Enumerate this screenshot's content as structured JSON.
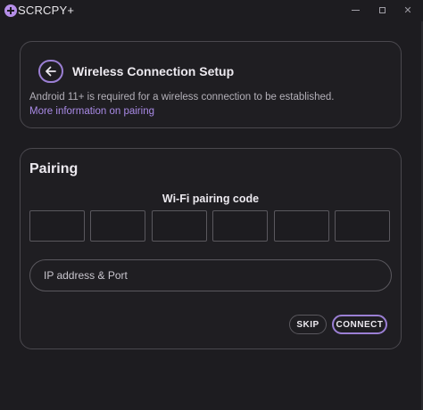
{
  "titlebar": {
    "app_name": "SCRCPY+",
    "icons": {
      "logo": "plus-circle-icon",
      "minimize": "minimize-icon",
      "maximize": "maximize-icon",
      "close": "close-icon"
    },
    "close_glyph": "✕"
  },
  "setup": {
    "back_icon": "arrow-left-icon",
    "title": "Wireless Connection Setup",
    "description": "Android 11+ is required for a wireless connection to be established.",
    "link": "More information on pairing"
  },
  "pairing": {
    "title": "Pairing",
    "code_label": "Wi-Fi pairing code",
    "code_digits": [
      "",
      "",
      "",
      "",
      "",
      ""
    ],
    "ip_value": "",
    "ip_placeholder": "IP address & Port",
    "skip_label": "SKIP",
    "connect_label": "CONNECT"
  },
  "colors": {
    "accent": "#9b7fd4",
    "link": "#a98ae6",
    "background": "#1d1c20",
    "border": "#4a484e"
  }
}
